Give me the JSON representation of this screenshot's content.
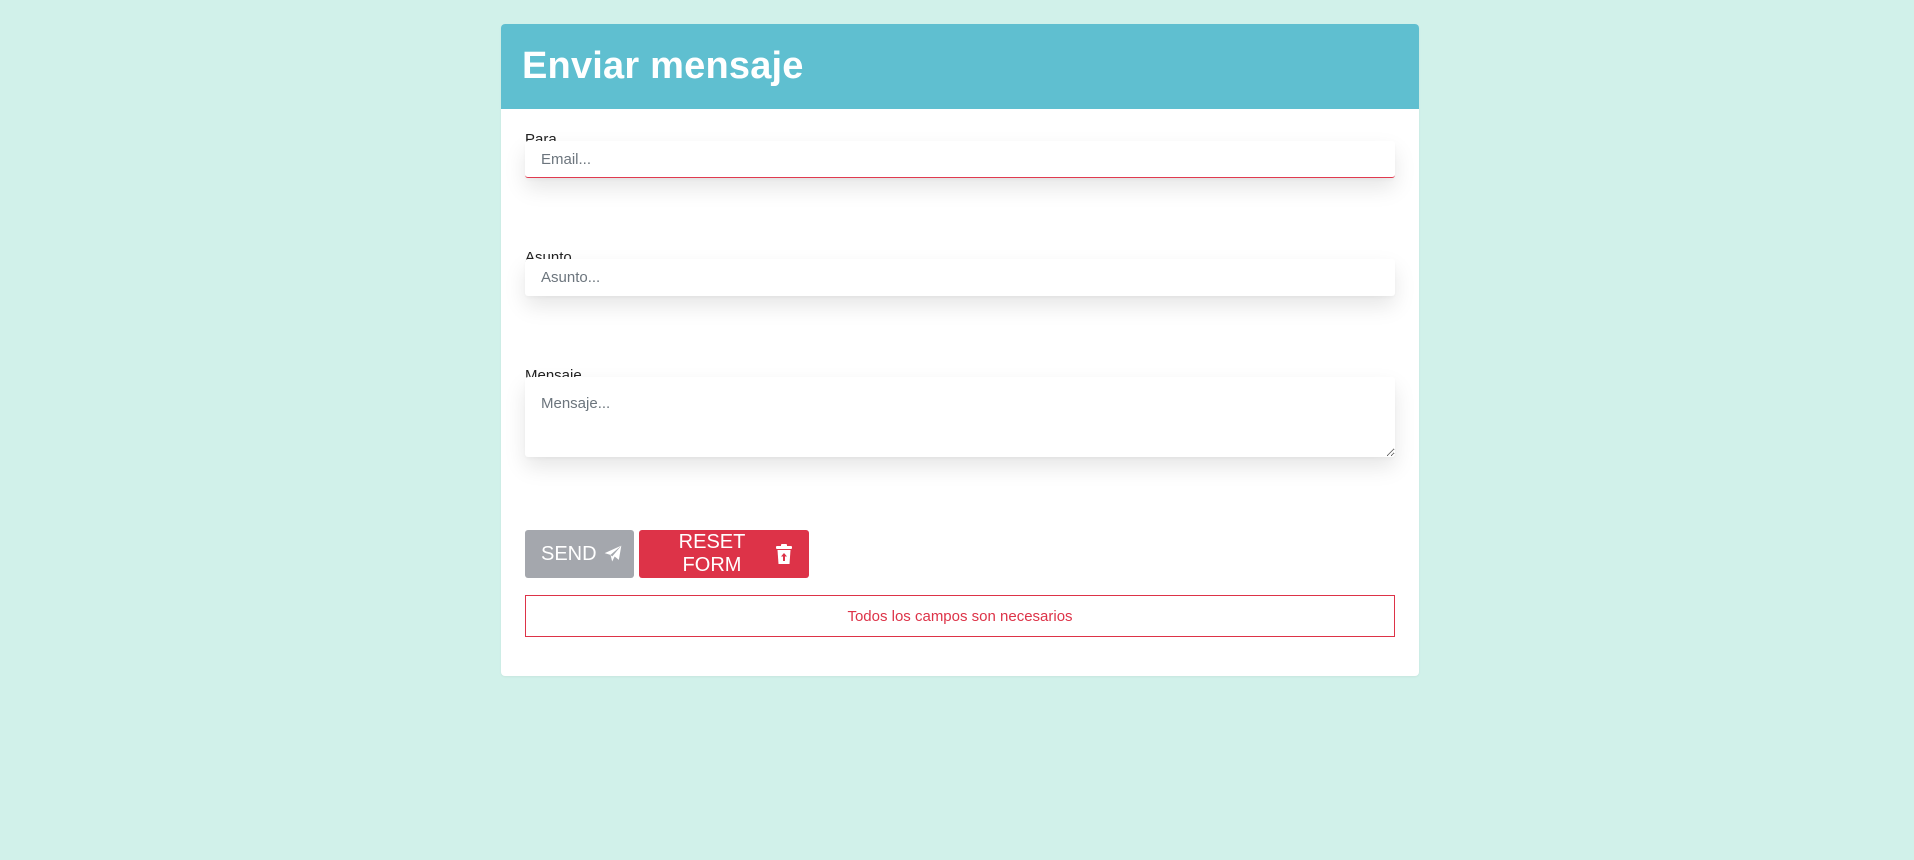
{
  "form": {
    "title": "Enviar mensaje",
    "fields": {
      "to": {
        "label": "Para",
        "placeholder": "Email...",
        "value": ""
      },
      "subject": {
        "label": "Asunto",
        "placeholder": "Asunto...",
        "value": ""
      },
      "message": {
        "label": "Mensaje",
        "placeholder": "Mensaje...",
        "value": ""
      }
    },
    "buttons": {
      "send": {
        "label": "SEND",
        "icon": "paper-plane-icon"
      },
      "reset": {
        "label": "RESET FORM",
        "icon": "trash-icon"
      }
    },
    "error": "Todos los campos son necesarios"
  },
  "colors": {
    "background": "#d1f1ea",
    "header": "#5fbfd0",
    "send_disabled": "#a4a7ad",
    "danger": "#dd3348"
  }
}
